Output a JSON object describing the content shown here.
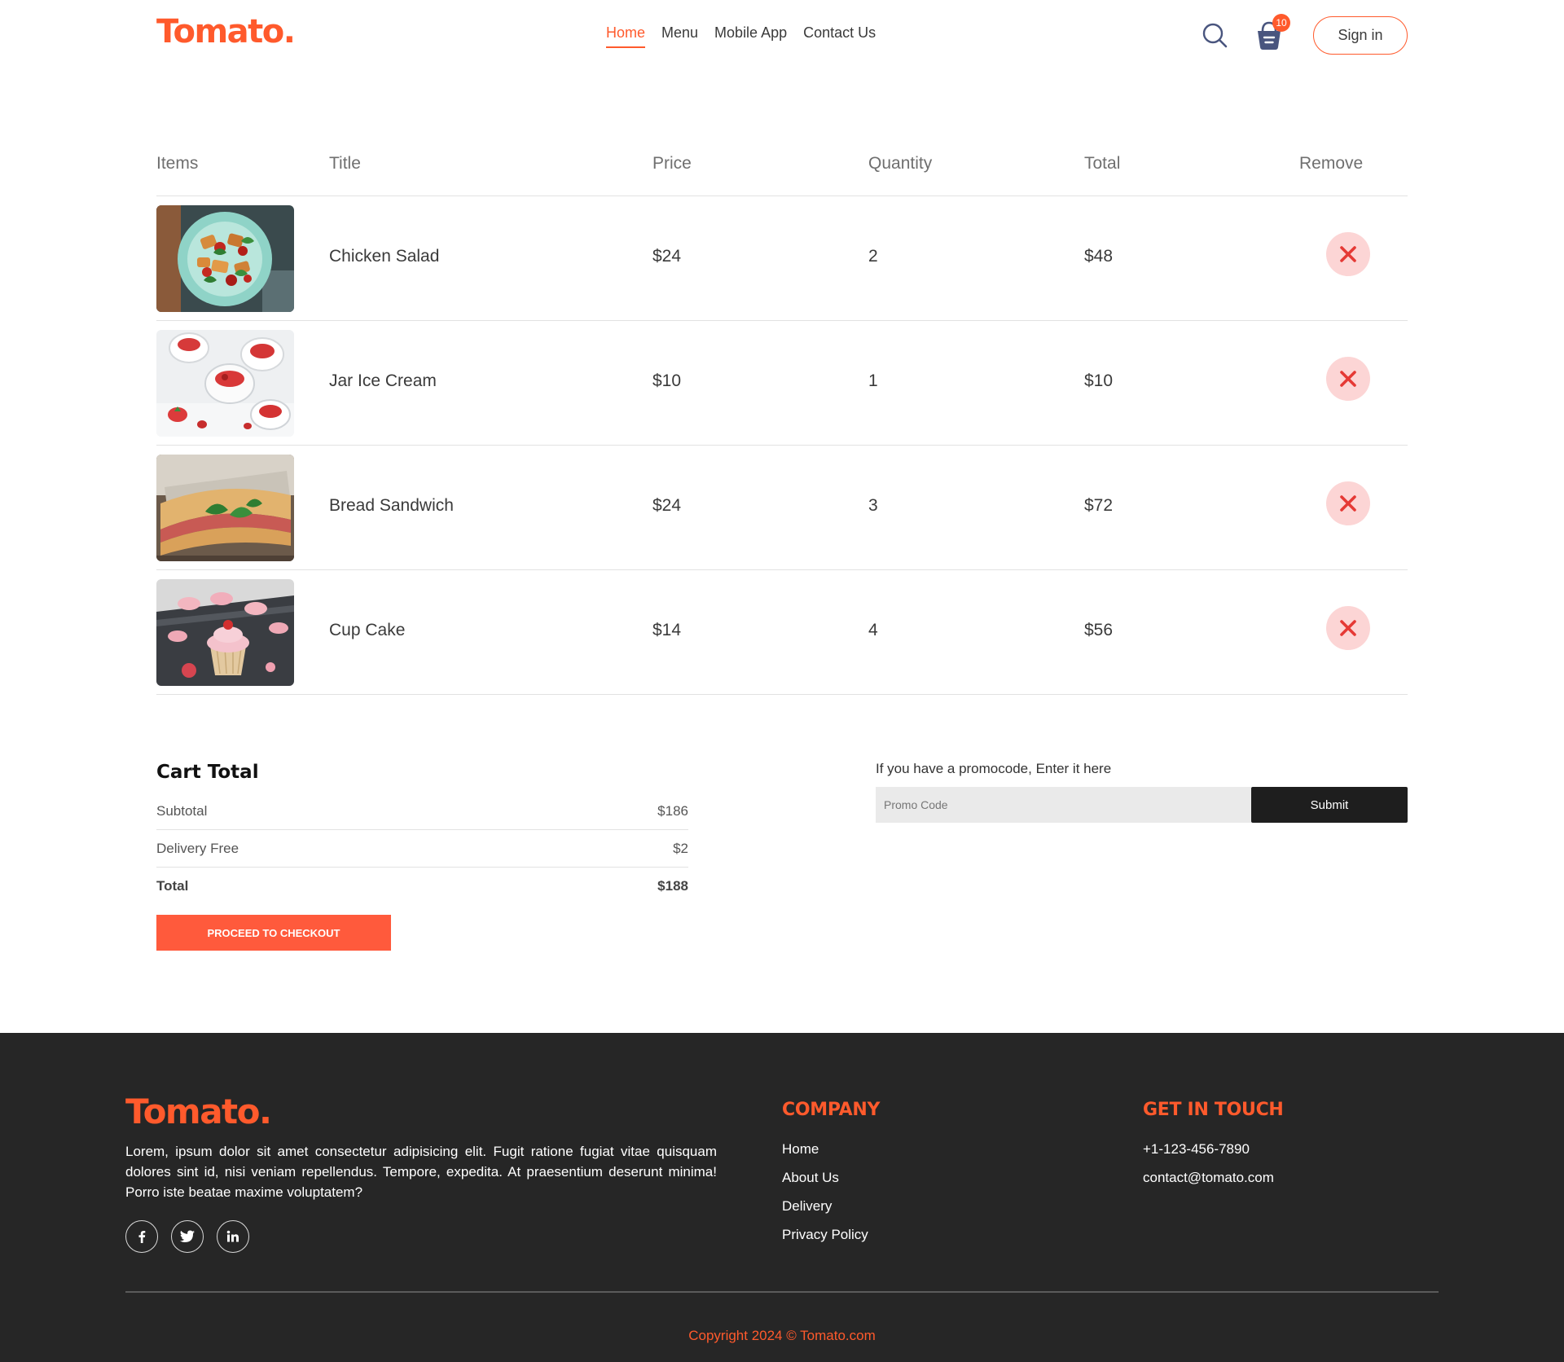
{
  "brand": {
    "logo_text": "Tomato.",
    "accent_color": "#ff5a2c"
  },
  "navbar": {
    "menu": [
      {
        "label": "Home",
        "active": true
      },
      {
        "label": "Menu",
        "active": false
      },
      {
        "label": "Mobile App",
        "active": false
      },
      {
        "label": "Contact Us",
        "active": false
      }
    ],
    "search_icon": "search-icon",
    "basket_icon": "basket-icon",
    "basket_count": "10",
    "signin_label": "Sign in"
  },
  "cart": {
    "headers": {
      "items": "Items",
      "title": "Title",
      "price": "Price",
      "quantity": "Quantity",
      "total": "Total",
      "remove": "Remove"
    },
    "rows": [
      {
        "image": "chicken-salad-photo",
        "title": "Chicken Salad",
        "price": "$24",
        "quantity": "2",
        "total": "$48"
      },
      {
        "image": "jar-ice-cream-photo",
        "title": "Jar Ice Cream",
        "price": "$10",
        "quantity": "1",
        "total": "$10"
      },
      {
        "image": "bread-sandwich-photo",
        "title": "Bread Sandwich",
        "price": "$24",
        "quantity": "3",
        "total": "$72"
      },
      {
        "image": "cup-cake-photo",
        "title": "Cup Cake",
        "price": "$14",
        "quantity": "4",
        "total": "$56"
      }
    ],
    "remove_icon": "close-icon",
    "remove_color": "#e53935",
    "remove_bg": "#fcd5d5"
  },
  "cart_total": {
    "heading": "Cart Total",
    "subtotal_label": "Subtotal",
    "subtotal_value": "$186",
    "delivery_label": "Delivery Free",
    "delivery_value": "$2",
    "total_label": "Total",
    "total_value": "$188",
    "checkout_label": "PROCEED TO CHECKOUT"
  },
  "promo": {
    "prompt": "If you have a promocode, Enter it here",
    "placeholder": "Promo Code",
    "value": "",
    "submit_label": "Submit"
  },
  "footer": {
    "logo_text": "Tomato.",
    "description": "Lorem, ipsum dolor sit amet consectetur adipisicing elit. Fugit ratione fugiat vitae quisquam dolores sint id, nisi veniam repellendus. Tempore, expedita. At praesentium deserunt minima! Porro iste beatae maxime voluptatem?",
    "social_icons": [
      "facebook-icon",
      "twitter-icon",
      "linkedin-icon"
    ],
    "company": {
      "heading": "COMPANY",
      "links": [
        "Home",
        "About Us",
        "Delivery",
        "Privacy Policy"
      ]
    },
    "contact": {
      "heading": "GET IN TOUCH",
      "phone": "+1-123-456-7890",
      "email": "contact@tomato.com"
    },
    "copyright": "Copyright 2024 © Tomato.com",
    "background": "#262626"
  }
}
